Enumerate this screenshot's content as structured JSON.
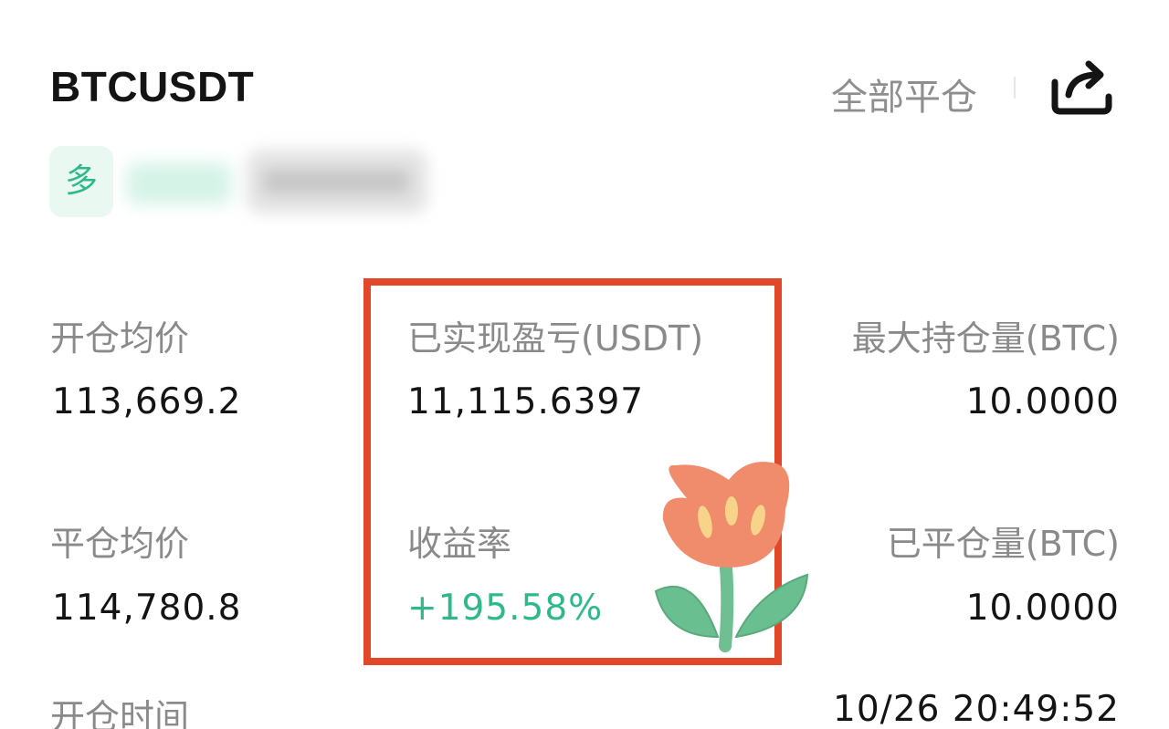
{
  "header": {
    "symbol": "BTCUSDT",
    "close_all_label": "全部平仓",
    "share_icon": "share-icon"
  },
  "position": {
    "side_tag": "多"
  },
  "stats": {
    "avg_open_price": {
      "label": "开仓均价",
      "value": "113,669.2"
    },
    "realized_pnl": {
      "label": "已实现盈亏(USDT)",
      "value": "11,115.6397"
    },
    "max_position": {
      "label": "最大持仓量(BTC)",
      "value": "10.0000"
    },
    "avg_close_price": {
      "label": "平仓均价",
      "value": "114,780.8"
    },
    "roi": {
      "label": "收益率",
      "value": "+195.58%"
    },
    "closed_qty": {
      "label": "已平仓量(BTC)",
      "value": "10.0000"
    },
    "open_time": {
      "label": "开仓时间",
      "value": "10/26 20:49:52"
    }
  },
  "colors": {
    "accent_green": "#2fb88b",
    "highlight_red": "#e2472a",
    "label_gray": "#8a8a8a",
    "text_dark": "#141414"
  },
  "decorations": {
    "sticker": "flower-sticker"
  }
}
